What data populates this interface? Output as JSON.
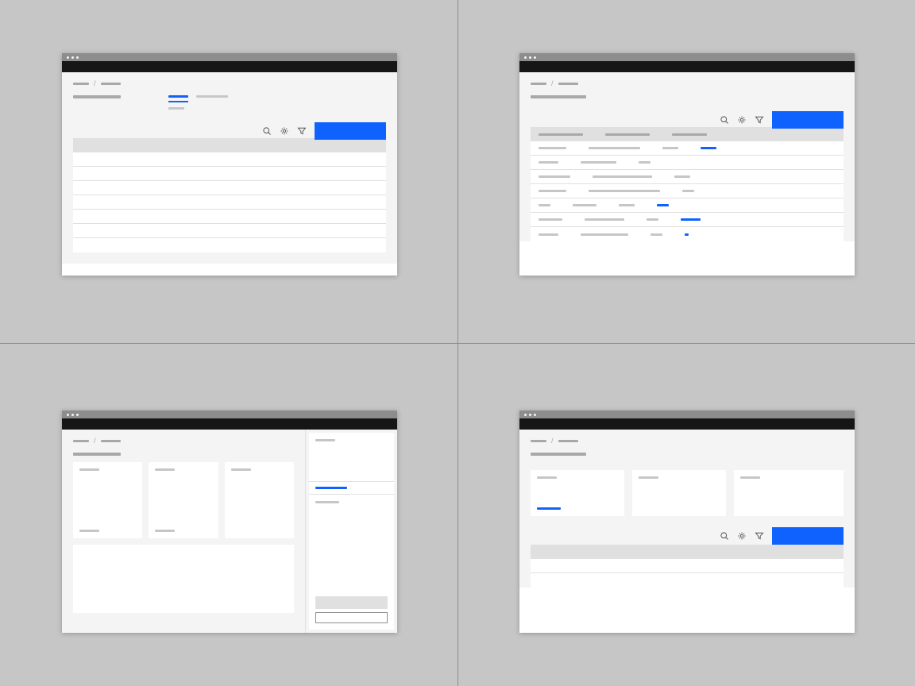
{
  "colors": {
    "accent": "#0f62fe"
  },
  "panels": {
    "a": {
      "breadcrumb": [
        "▬▬▬▬",
        "▬▬▬▬▬"
      ],
      "title": "▬▬▬▬▬▬▬▬▬▬▬▬",
      "tabs": [
        {
          "label": "▬▬▬▬▬",
          "active": true
        },
        {
          "label": "▬▬▬▬▬▬▬▬",
          "active": false
        }
      ],
      "subtitle": "▬▬▬▬",
      "toolbar_button": "",
      "table": {
        "headers": [],
        "rows": [
          [],
          [],
          [],
          [],
          [],
          [],
          []
        ]
      }
    },
    "b": {
      "breadcrumb": [
        "▬▬▬▬",
        "▬▬▬▬▬"
      ],
      "title": "▬▬▬▬▬▬▬▬▬▬▬▬▬▬",
      "toolbar_button": "",
      "table": {
        "headers": [
          "▬▬▬▬▬▬",
          "▬▬▬▬▬▬",
          "▬▬▬▬▬"
        ],
        "rows": [
          {
            "c1": "▬▬▬▬▬▬▬",
            "c2": "▬▬▬▬▬▬▬▬▬▬▬▬▬",
            "c3": "▬▬▬▬",
            "link": "▬▬▬▬"
          },
          {
            "c1": "▬▬▬▬▬",
            "c2": "▬▬▬▬▬▬▬▬▬",
            "c3": "▬▬▬",
            "link": ""
          },
          {
            "c1": "▬▬▬▬▬▬▬▬",
            "c2": "▬▬▬▬▬▬▬▬▬▬▬▬▬▬▬",
            "c3": "▬▬▬▬",
            "link": ""
          },
          {
            "c1": "▬▬▬▬▬▬▬",
            "c2": "▬▬▬▬▬▬▬▬▬▬▬▬▬▬▬▬▬▬",
            "c3": "▬▬▬",
            "link": ""
          },
          {
            "c1": "▬▬▬",
            "c2": "▬▬▬▬▬▬",
            "c3": "▬▬▬▬",
            "link": "▬▬▬"
          },
          {
            "c1": "▬▬▬▬▬▬",
            "c2": "▬▬▬▬▬▬▬▬▬▬",
            "c3": "▬▬▬",
            "link": "▬▬▬▬▬"
          },
          {
            "c1": "▬▬▬▬▬",
            "c2": "▬▬▬▬▬▬▬▬▬▬▬▬",
            "c3": "▬▬▬",
            "link": "▬"
          }
        ]
      }
    },
    "c": {
      "breadcrumb": [
        "▬▬▬▬",
        "▬▬▬▬▬"
      ],
      "title": "▬▬▬▬▬▬▬▬▬▬▬▬",
      "cards": [
        {
          "label": "▬▬▬▬▬",
          "footer": "▬▬▬▬▬"
        },
        {
          "label": "▬▬▬▬▬",
          "footer": "▬▬▬▬▬"
        },
        {
          "label": "▬▬▬▬▬",
          "footer": ""
        }
      ],
      "side": {
        "top_label": "▬▬▬▬▬",
        "link": "▬▬▬▬▬▬▬▬",
        "mid_label": "▬▬▬▬▬▬",
        "input_value": ""
      }
    },
    "d": {
      "breadcrumb": [
        "▬▬▬▬",
        "▬▬▬▬▬"
      ],
      "title": "▬▬▬▬▬▬▬▬▬▬▬▬▬▬",
      "cards": [
        {
          "label": "▬▬▬▬▬",
          "link": "▬▬▬▬▬▬"
        },
        {
          "label": "▬▬▬▬▬"
        },
        {
          "label": "▬▬▬▬▬"
        }
      ],
      "toolbar_button": "",
      "table": {
        "headers": [],
        "rows": [
          [],
          []
        ]
      }
    }
  }
}
